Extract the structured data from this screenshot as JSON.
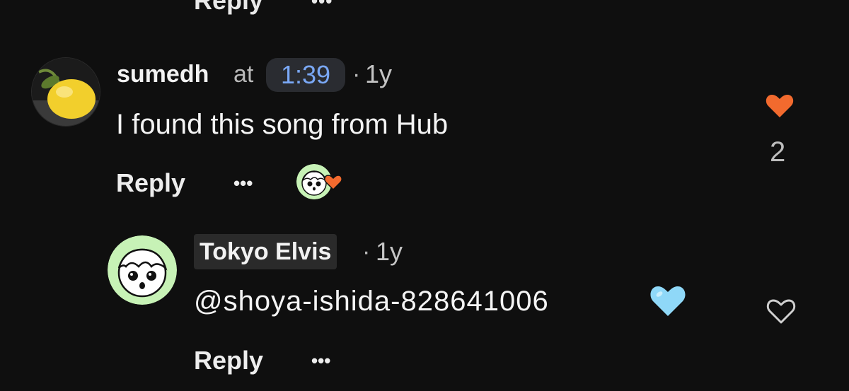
{
  "previous_comment": {
    "reply_label": "Reply",
    "more_label": "•••"
  },
  "comment": {
    "username": "sumedh",
    "at_word": "at",
    "timestamp": "1:39",
    "separator": "·",
    "age": "1y",
    "text": "I found this song from Hub",
    "reply_label": "Reply",
    "more_label": "•••",
    "like_count": "2",
    "liked": true,
    "avatar_icon": "lemon-avatar",
    "creator_heart_icon": "creator-heart-badge"
  },
  "reply": {
    "username": "Tokyo Elvis",
    "separator": "·",
    "age": "1y",
    "text": "@shoya-ishida-828641006",
    "emoji": "🩵",
    "reply_label": "Reply",
    "more_label": "•••",
    "liked": false,
    "avatar_icon": "cartoon-face-avatar"
  },
  "colors": {
    "background": "#0f0f0f",
    "timestamp_link": "#7aa8f5",
    "like_active": "#f26a2e",
    "avatar_green": "#c7f2b6",
    "blue_heart": "#8fd8f8"
  }
}
